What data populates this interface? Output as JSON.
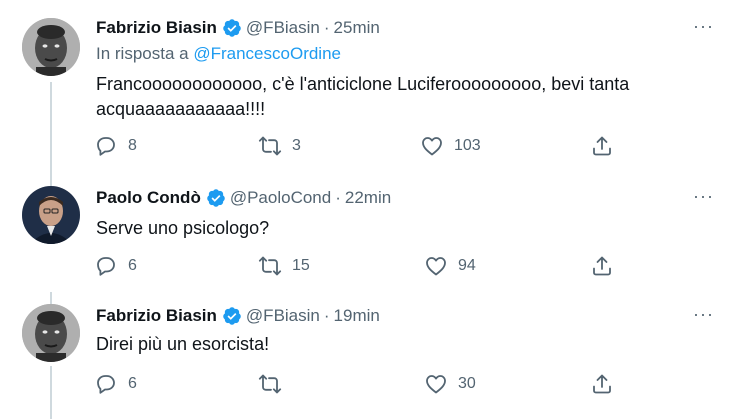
{
  "tweets": [
    {
      "name": "Fabrizio Biasin",
      "handle": "@FBiasin",
      "time": "25min",
      "reply_prefix": "In risposta a",
      "reply_handle": "@FrancescoOrdine",
      "text_line1": "Francoooooooooooo, c'è l'anticiclone Luciferooooooooo, bevi tanta",
      "text_line2": "acquaaaaaaaaaaa!!!!",
      "replies": "8",
      "retweets": "3",
      "likes": "103"
    },
    {
      "name": "Paolo Condò",
      "handle": "@PaoloCond",
      "time": "22min",
      "text_line1": "Serve uno psicologo?",
      "replies": "6",
      "retweets": "15",
      "likes": "94"
    },
    {
      "name": "Fabrizio Biasin",
      "handle": "@FBiasin",
      "time": "19min",
      "text_line1": "Direi più un esorcista!",
      "replies": "6",
      "retweets": "",
      "likes": "30"
    }
  ],
  "ui": {
    "dot": "·",
    "more": "···"
  },
  "colors": {
    "accent": "#1d9bf0",
    "secondary_text": "#536471",
    "thread_line": "#cfd9de"
  },
  "icons": [
    "verified-badge-icon",
    "reply-icon",
    "retweet-icon",
    "like-icon",
    "share-icon",
    "more-icon"
  ]
}
